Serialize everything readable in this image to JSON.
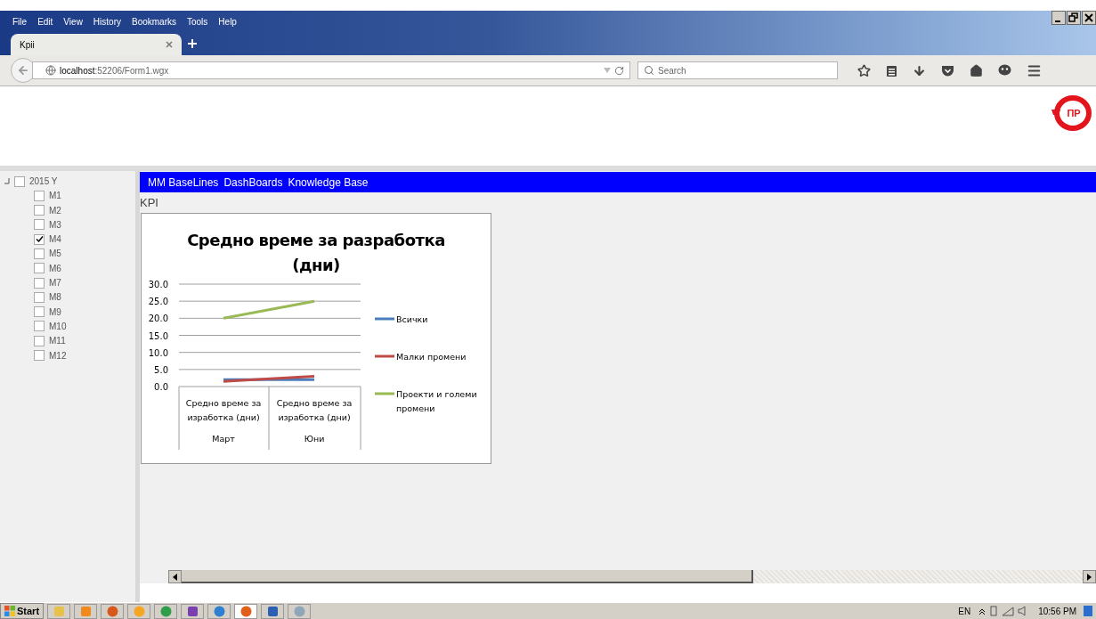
{
  "browser": {
    "menu": [
      "File",
      "Edit",
      "View",
      "History",
      "Bookmarks",
      "Tools",
      "Help"
    ],
    "tabs": [
      {
        "title": "Kpii",
        "selected": true
      }
    ],
    "address": {
      "host": "localhost",
      "path": ":52206/Form1.wgx"
    },
    "search": {
      "placeholder": "Search"
    }
  },
  "header": {
    "logo_text": "ПР"
  },
  "tree": {
    "label": "2015 Y",
    "checked": false,
    "expanded": true,
    "children": [
      {
        "label": "M1",
        "checked": false
      },
      {
        "label": "M2",
        "checked": false
      },
      {
        "label": "M3",
        "checked": false
      },
      {
        "label": "M4",
        "checked": true
      },
      {
        "label": "M5",
        "checked": false
      },
      {
        "label": "M6",
        "checked": false
      },
      {
        "label": "M7",
        "checked": false
      },
      {
        "label": "M8",
        "checked": false
      },
      {
        "label": "M9",
        "checked": false
      },
      {
        "label": "M10",
        "checked": false
      },
      {
        "label": "M11",
        "checked": false
      },
      {
        "label": "M12",
        "checked": false
      }
    ]
  },
  "nav": [
    "MM BaseLines",
    "DashBoards",
    "Knowledge Base"
  ],
  "section_title": "KPI",
  "chart": {
    "category_headers": [
      "Средно време за изработка (дни)",
      "Средно време за изработка (дни)"
    ],
    "chart_data": {
      "type": "line",
      "title": "Средно време за разработка (дни)",
      "categories": [
        "Март",
        "Юни"
      ],
      "series": [
        {
          "name": "Всички",
          "color": "#4a7ebb",
          "values": [
            2.0,
            2.0
          ]
        },
        {
          "name": "Малки промени",
          "color": "#be4b48",
          "values": [
            1.5,
            3.0
          ]
        },
        {
          "name": "Проекти и големи промени",
          "color": "#98b954",
          "values": [
            20.0,
            25.0
          ]
        }
      ],
      "ylim": [
        0,
        30
      ],
      "grid": true,
      "legend": true,
      "yticks": [
        {
          "value": 0,
          "label": "0.0"
        },
        {
          "value": 5,
          "label": "5.0"
        },
        {
          "value": 10,
          "label": "10.0"
        },
        {
          "value": 15,
          "label": "15.0"
        },
        {
          "value": 20,
          "label": "20.0"
        },
        {
          "value": 25,
          "label": "25.0"
        },
        {
          "value": 30,
          "label": "30.0"
        }
      ]
    }
  },
  "taskbar": {
    "start": "Start",
    "language": "EN",
    "clock": "10:56 PM"
  }
}
